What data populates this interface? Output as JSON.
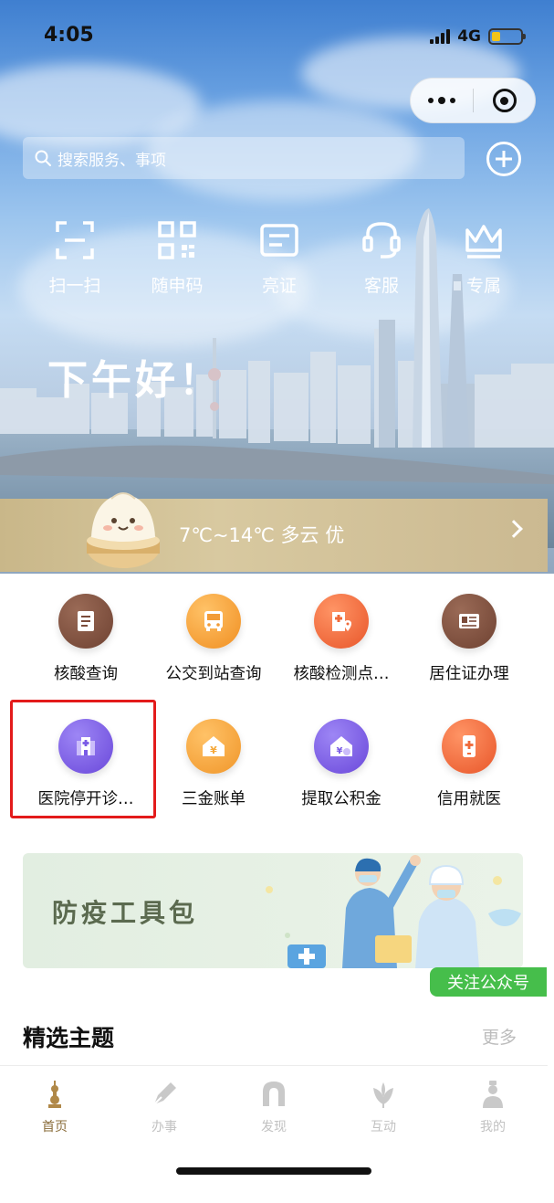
{
  "status": {
    "time": "4:05",
    "network": "4G"
  },
  "header": {
    "search_placeholder": "搜索服务、事项"
  },
  "quick_actions": [
    {
      "label": "扫一扫",
      "icon": "scan-icon"
    },
    {
      "label": "随申码",
      "icon": "qr-code-icon"
    },
    {
      "label": "亮证",
      "icon": "id-card-icon"
    },
    {
      "label": "客服",
      "icon": "headset-icon"
    },
    {
      "label": "专属",
      "icon": "crown-icon"
    }
  ],
  "greeting": "下午好！",
  "weather": {
    "text": "7℃~14℃ 多云 优"
  },
  "services": [
    [
      {
        "label": "核酸查询",
        "icon": "document-icon",
        "color": "#7b4b3a"
      },
      {
        "label": "公交到站查询",
        "icon": "bus-icon",
        "color": "#f29b36"
      },
      {
        "label": "核酸检测点…",
        "icon": "hospital-location-icon",
        "color": "#ef6a3a"
      },
      {
        "label": "居住证办理",
        "icon": "id-card-icon",
        "color": "#7b4b3a"
      }
    ],
    [
      {
        "label": "医院停开诊…",
        "icon": "hospital-building-icon",
        "color": "#7a5be6"
      },
      {
        "label": "三金账单",
        "icon": "money-house-icon",
        "color": "#f5a83a"
      },
      {
        "label": "提取公积金",
        "icon": "fund-house-icon",
        "color": "#7a5be6"
      },
      {
        "label": "信用就医",
        "icon": "medical-phone-icon",
        "color": "#ef6a3a"
      }
    ]
  ],
  "banner": {
    "title": "防疫工具包",
    "follow_label": "关注公众号"
  },
  "featured": {
    "title": "精选主题",
    "more_label": "更多"
  },
  "tabbar": [
    {
      "label": "首页",
      "icon": "home-tower-icon",
      "active": true
    },
    {
      "label": "办事",
      "icon": "pen-icon",
      "active": false
    },
    {
      "label": "发现",
      "icon": "arch-icon",
      "active": false
    },
    {
      "label": "互动",
      "icon": "flower-icon",
      "active": false
    },
    {
      "label": "我的",
      "icon": "person-icon",
      "active": false
    }
  ]
}
